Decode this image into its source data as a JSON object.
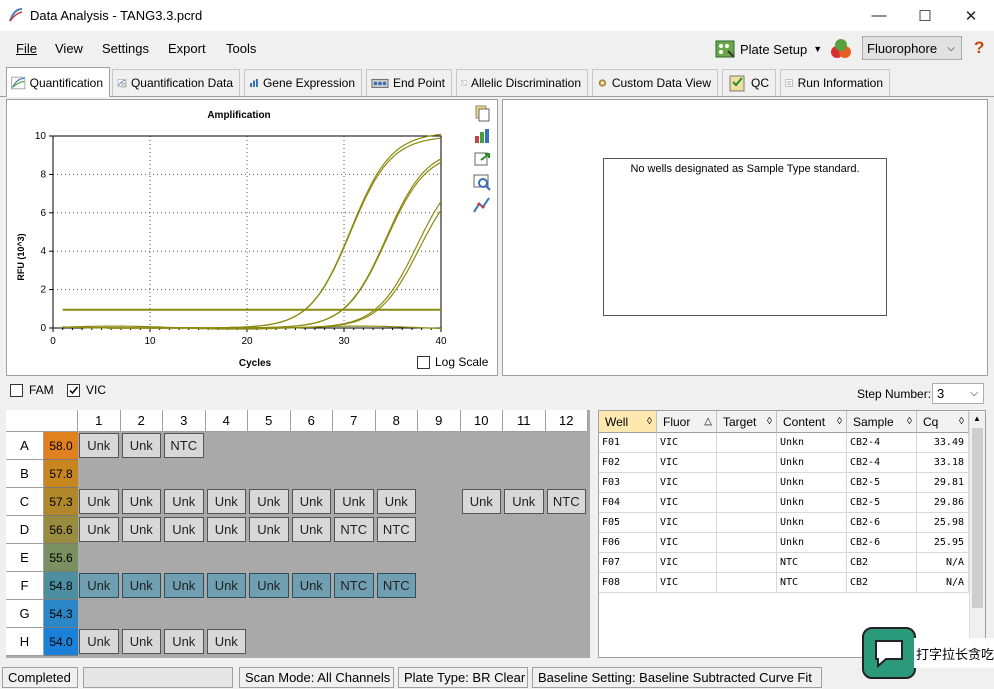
{
  "window": {
    "title": "Data Analysis - TANG3.3.pcrd",
    "minimize": "—",
    "maximize": "☐",
    "close": "✕"
  },
  "menu": [
    "File",
    "View",
    "Settings",
    "Export",
    "Tools"
  ],
  "toolbar": {
    "plate_setup": "Plate Setup",
    "fluorophore": "Fluorophore"
  },
  "tabs": [
    "Quantification",
    "Quantification Data",
    "Gene Expression",
    "End Point",
    "Allelic Discrimination",
    "Custom Data View",
    "QC",
    "Run Information"
  ],
  "std_curve": {
    "message": "No wells designated as Sample Type standard."
  },
  "controls": {
    "fam": "FAM",
    "vic": "VIC",
    "step_label": "Step Number:",
    "step_value": "3",
    "log_scale": "Log Scale"
  },
  "chart_data": {
    "type": "line",
    "title": "Amplification",
    "xlabel": "Cycles",
    "ylabel": "RFU (10^3)",
    "xlim": [
      0,
      40
    ],
    "ylim": [
      0,
      10
    ],
    "xticks": [
      "0",
      "10",
      "20",
      "30",
      "40"
    ],
    "yticks": [
      "0",
      "2",
      "4",
      "6",
      "8",
      "10"
    ],
    "grid": true,
    "threshold": 0.95,
    "line_color": "#8a8a10",
    "series": [
      {
        "cq": 25.95,
        "plateau": 10.2
      },
      {
        "cq": 25.98,
        "plateau": 10.0
      },
      {
        "cq": 29.81,
        "plateau": 9.4
      },
      {
        "cq": 29.86,
        "plateau": 9.2
      },
      {
        "cq": 33.18,
        "plateau": 8.6
      },
      {
        "cq": 33.49,
        "plateau": 8.2
      },
      {
        "cq": null,
        "plateau": 0
      }
    ]
  },
  "plate": {
    "columns": [
      "1",
      "2",
      "3",
      "4",
      "5",
      "6",
      "7",
      "8",
      "9",
      "10",
      "11",
      "12"
    ],
    "rows": [
      {
        "label": "A",
        "temp": "58.0",
        "color": "#e0801e",
        "wells": [
          "Unk",
          "Unk",
          "NTC",
          "",
          "",
          "",
          "",
          "",
          "",
          "",
          "",
          ""
        ]
      },
      {
        "label": "B",
        "temp": "57.8",
        "color": "#c8861e",
        "wells": [
          "",
          "",
          "",
          "",
          "",
          "",
          "",
          "",
          "",
          "",
          "",
          ""
        ]
      },
      {
        "label": "C",
        "temp": "57.3",
        "color": "#b0882a",
        "wells": [
          "Unk",
          "Unk",
          "Unk",
          "Unk",
          "Unk",
          "Unk",
          "Unk",
          "Unk",
          "",
          "Unk",
          "Unk",
          "NTC"
        ]
      },
      {
        "label": "D",
        "temp": "56.6",
        "color": "#9a8c3e",
        "wells": [
          "Unk",
          "Unk",
          "Unk",
          "Unk",
          "Unk",
          "Unk",
          "NTC",
          "NTC",
          "",
          "",
          "",
          ""
        ]
      },
      {
        "label": "E",
        "temp": "55.6",
        "color": "#7a9060",
        "wells": [
          "",
          "",
          "",
          "",
          "",
          "",
          "",
          "",
          "",
          "",
          "",
          ""
        ]
      },
      {
        "label": "F",
        "temp": "54.8",
        "color": "#4d8ea0",
        "wells": [
          "Unk",
          "Unk",
          "Unk",
          "Unk",
          "Unk",
          "Unk",
          "NTC",
          "NTC",
          "",
          "",
          "",
          ""
        ]
      },
      {
        "label": "G",
        "temp": "54.3",
        "color": "#2a86c6",
        "wells": [
          "",
          "",
          "",
          "",
          "",
          "",
          "",
          "",
          "",
          "",
          "",
          ""
        ]
      },
      {
        "label": "H",
        "temp": "54.0",
        "color": "#1a80d8",
        "wells": [
          "Unk",
          "Unk",
          "Unk",
          "Unk",
          "",
          "",
          "",
          "",
          "",
          "",
          "",
          ""
        ]
      }
    ],
    "selected_row": "F"
  },
  "table": {
    "headers": [
      "Well",
      "Fluor",
      "Target",
      "Content",
      "Sample",
      "Cq"
    ],
    "rows": [
      [
        "F01",
        "VIC",
        "",
        "Unkn",
        "CB2-4",
        "33.49"
      ],
      [
        "F02",
        "VIC",
        "",
        "Unkn",
        "CB2-4",
        "33.18"
      ],
      [
        "F03",
        "VIC",
        "",
        "Unkn",
        "CB2-5",
        "29.81"
      ],
      [
        "F04",
        "VIC",
        "",
        "Unkn",
        "CB2-5",
        "29.86"
      ],
      [
        "F05",
        "VIC",
        "",
        "Unkn",
        "CB2-6",
        "25.98"
      ],
      [
        "F06",
        "VIC",
        "",
        "Unkn",
        "CB2-6",
        "25.95"
      ],
      [
        "F07",
        "VIC",
        "",
        "NTC",
        "CB2",
        "N/A"
      ],
      [
        "F08",
        "VIC",
        "",
        "NTC",
        "CB2",
        "N/A"
      ]
    ]
  },
  "status": {
    "state": "Completed",
    "scan_mode": "Scan Mode: All Channels",
    "plate_type": "Plate Type: BR Clear",
    "baseline": "Baseline Setting: Baseline Subtracted Curve Fit"
  },
  "overlay": {
    "text": "打字拉长贪吃"
  }
}
